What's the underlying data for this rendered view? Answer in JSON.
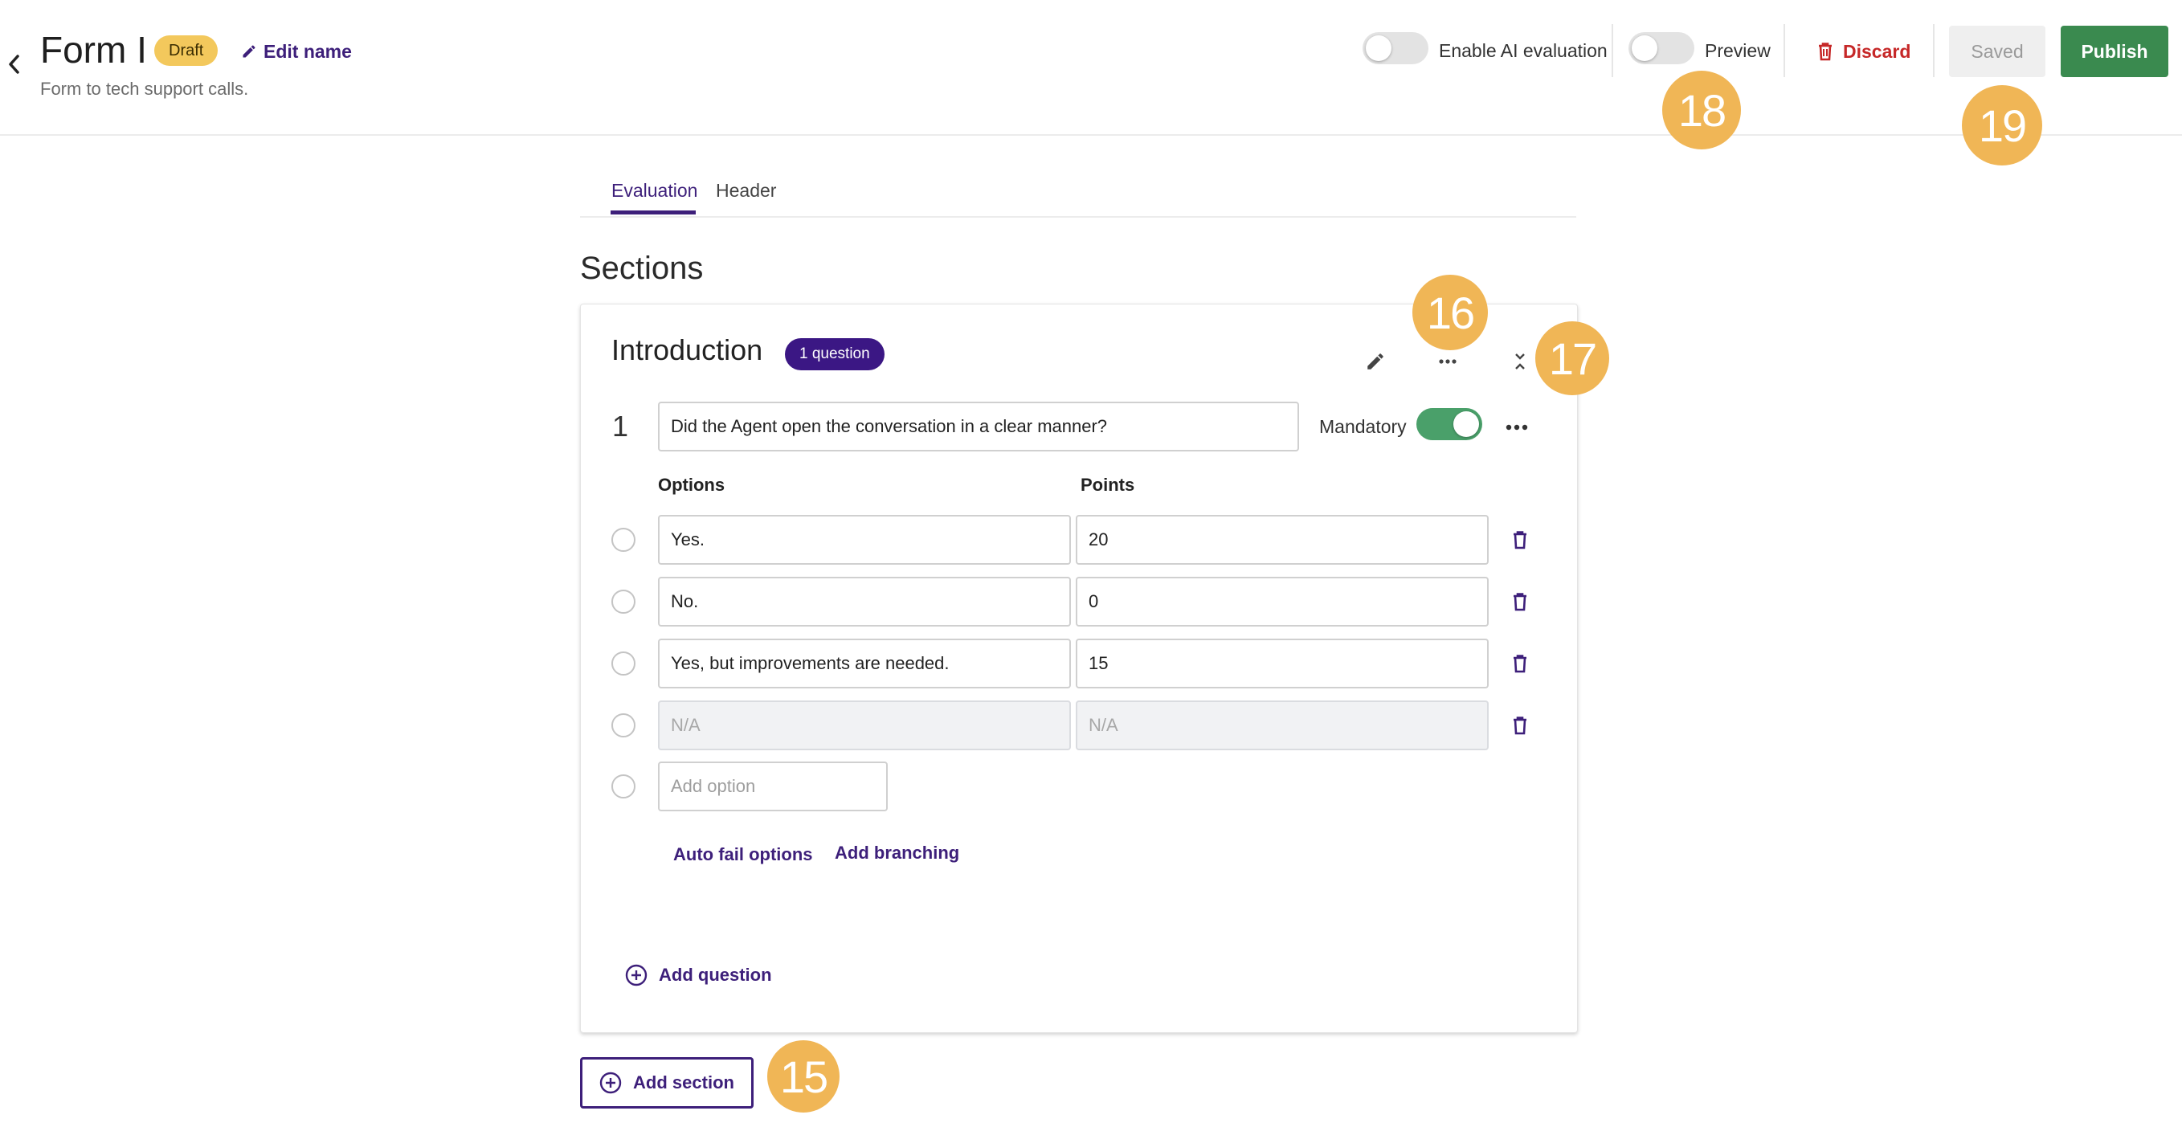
{
  "header": {
    "title": "Form I",
    "status_badge": "Draft",
    "edit_name_label": "Edit name",
    "subtitle": "Form to tech support calls.",
    "ai_eval_label": "Enable AI evaluation",
    "ai_eval_on": false,
    "preview_label": "Preview",
    "preview_on": false,
    "discard_label": "Discard",
    "saved_label": "Saved",
    "publish_label": "Publish"
  },
  "tabs": [
    {
      "label": "Evaluation",
      "active": true
    },
    {
      "label": "Header",
      "active": false
    }
  ],
  "sections_heading": "Sections",
  "section": {
    "title": "Introduction",
    "question_count_badge": "1 question",
    "question": {
      "number": "1",
      "text": "Did the Agent open the conversation in a clear manner?",
      "mandatory_label": "Mandatory",
      "mandatory_on": true,
      "options_header": "Options",
      "points_header": "Points",
      "options": [
        {
          "option": "Yes.",
          "points": "20"
        },
        {
          "option": "No.",
          "points": "0"
        },
        {
          "option": "Yes, but improvements are needed.",
          "points": "15"
        },
        {
          "option_placeholder": "N/A",
          "points_placeholder": "N/A"
        }
      ],
      "add_option_placeholder": "Add option",
      "auto_fail_label": "Auto fail options",
      "add_branching_label": "Add branching"
    },
    "add_question_label": "Add question"
  },
  "add_section_label": "Add section",
  "markers": [
    "15",
    "16",
    "17",
    "18",
    "19"
  ],
  "colors": {
    "accent": "#3d1f7a",
    "badge_draft": "#f3c85c",
    "publish": "#3a8a4f",
    "discard": "#c62828",
    "toggle_on": "#4aa06a",
    "marker": "#f0b656"
  },
  "icons": [
    "chevron-left-icon",
    "pencil-icon",
    "trash-icon",
    "more-horizontal-icon",
    "collapse-icon",
    "plus-circle-icon"
  ]
}
